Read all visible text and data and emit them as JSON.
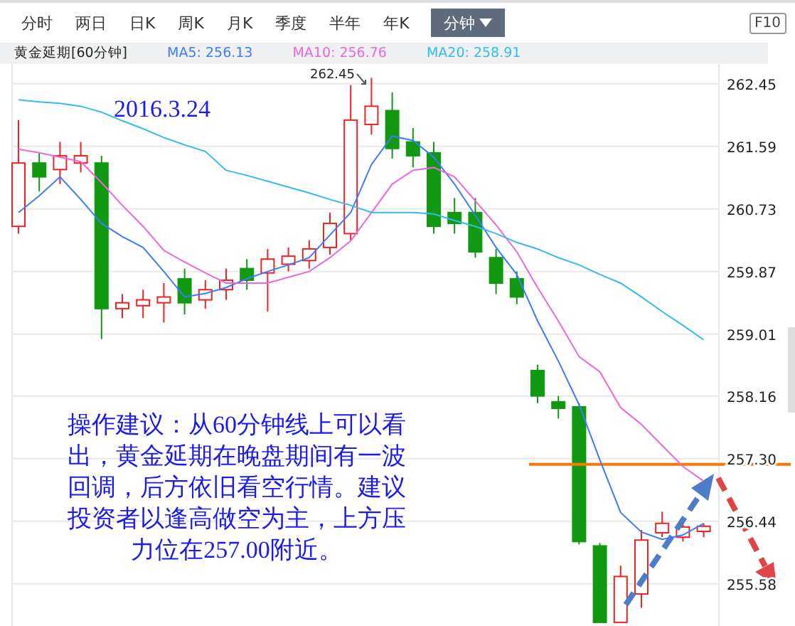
{
  "tabs": [
    {
      "label": "分时",
      "selected": false
    },
    {
      "label": "两日",
      "selected": false
    },
    {
      "label": "日K",
      "selected": false
    },
    {
      "label": "周K",
      "selected": false
    },
    {
      "label": "月K",
      "selected": false
    },
    {
      "label": "季度",
      "selected": false
    },
    {
      "label": "半年",
      "selected": false
    },
    {
      "label": "年K",
      "selected": false
    },
    {
      "label": "分钟",
      "selected": true
    }
  ],
  "f10_button": "F10",
  "info_bar": {
    "title": "黄金延期[60分钟]",
    "averages": [
      {
        "label": "MA5: 256.13",
        "color": "#3a7bff"
      },
      {
        "label": "MA10: 256.76",
        "color": "#ee66dd"
      },
      {
        "label": "MA20: 258.91",
        "color": "#33bbee"
      }
    ]
  },
  "chart": {
    "max_label": "262.45",
    "date_note": "2016.3.24",
    "advice": "操作建议：从60分钟线上可以看出，黄金延期在晚盘期间有一波回调，后方依旧看空行情。建议投资者以逢高做空为主，上方压力位在257.00附近。",
    "chart_data": {
      "type": "candlestick",
      "grid": true,
      "ylim": [
        255.0,
        262.72
      ],
      "yticks": [
        {
          "value": 262.45,
          "label": "262.45"
        },
        {
          "value": 261.59,
          "label": "261.59"
        },
        {
          "value": 260.73,
          "label": "260.73"
        },
        {
          "value": 259.87,
          "label": "259.87"
        },
        {
          "value": 259.01,
          "label": "259.01"
        },
        {
          "value": 258.16,
          "label": "258.16"
        },
        {
          "value": 257.3,
          "label": "257.30"
        },
        {
          "value": 256.44,
          "label": "256.44"
        },
        {
          "value": 255.58,
          "label": "255.58"
        }
      ],
      "ref_lines": [
        {
          "axis": "y",
          "value": 257.22,
          "color": "#ff7700"
        }
      ],
      "ohlc": [
        [
          260.49,
          261.95,
          260.39,
          261.36
        ],
        [
          261.36,
          261.5,
          260.97,
          261.17
        ],
        [
          261.27,
          261.65,
          261.07,
          261.46
        ],
        [
          261.36,
          261.65,
          261.23,
          261.46
        ],
        [
          261.36,
          261.46,
          258.94,
          259.36
        ],
        [
          259.36,
          259.56,
          259.23,
          259.44
        ],
        [
          259.4,
          259.62,
          259.23,
          259.48
        ],
        [
          259.44,
          259.71,
          259.17,
          259.52
        ],
        [
          259.77,
          259.91,
          259.28,
          259.44
        ],
        [
          259.48,
          259.75,
          259.36,
          259.62
        ],
        [
          259.62,
          259.91,
          259.48,
          259.75
        ],
        [
          259.91,
          260.04,
          259.62,
          259.75
        ],
        [
          259.85,
          260.18,
          259.32,
          260.04
        ],
        [
          259.97,
          260.2,
          259.87,
          260.08
        ],
        [
          260.02,
          260.3,
          259.91,
          260.18
        ],
        [
          260.2,
          260.68,
          260.1,
          260.53
        ],
        [
          260.39,
          262.43,
          260.3,
          261.95
        ],
        [
          261.89,
          262.53,
          261.75,
          262.14
        ],
        [
          262.08,
          262.33,
          261.42,
          261.56
        ],
        [
          261.65,
          261.84,
          261.3,
          261.46
        ],
        [
          261.5,
          261.65,
          260.39,
          260.49
        ],
        [
          260.68,
          260.88,
          260.39,
          260.53
        ],
        [
          260.68,
          260.88,
          260.06,
          260.14
        ],
        [
          260.06,
          260.18,
          259.56,
          259.71
        ],
        [
          259.77,
          259.87,
          259.42,
          259.52
        ],
        [
          258.51,
          258.59,
          258.06,
          258.16
        ],
        [
          258.08,
          258.16,
          257.85,
          257.99
        ],
        [
          258.01,
          258.06,
          256.12,
          256.16
        ],
        [
          256.1,
          256.14,
          255.05,
          255.05
        ],
        [
          255.05,
          255.83,
          255.05,
          255.68
        ],
        [
          255.44,
          256.32,
          255.25,
          256.18
        ],
        [
          256.28,
          256.57,
          256.22,
          256.41
        ],
        [
          256.22,
          256.45,
          256.16,
          256.36
        ],
        [
          256.3,
          256.41,
          256.22,
          256.37
        ]
      ]
    }
  },
  "moving_averages": {
    "chart_data": {
      "type": "line",
      "ylim": [
        255.0,
        262.72
      ],
      "series": [
        {
          "color": "#3a7bff",
          "values": [
            260.68,
            260.91,
            261.17,
            260.86,
            260.53,
            260.35,
            260.2,
            259.87,
            259.52,
            259.57,
            259.65,
            259.77,
            259.87,
            259.96,
            260.06,
            260.37,
            260.68,
            261.34,
            261.73,
            261.67,
            261.44,
            261.07,
            260.64,
            260.2,
            259.83,
            259.19,
            258.64,
            258.04,
            257.28,
            256.56,
            256.29,
            256.19,
            256.25,
            256.41
          ]
        },
        {
          "color": "#ee66dd",
          "values": [
            261.55,
            261.5,
            261.44,
            261.38,
            261.09,
            260.78,
            260.49,
            260.16,
            260.0,
            259.85,
            259.71,
            259.71,
            259.71,
            259.79,
            259.87,
            260.06,
            260.29,
            260.68,
            261.07,
            261.26,
            261.3,
            261.17,
            260.84,
            260.51,
            260.14,
            259.65,
            259.19,
            258.7,
            258.49,
            258.0,
            257.77,
            257.48,
            257.19,
            256.99
          ]
        },
        {
          "color": "#33bbee",
          "values": [
            262.23,
            262.2,
            262.18,
            262.14,
            262.06,
            261.94,
            261.83,
            261.71,
            261.61,
            261.52,
            261.26,
            261.19,
            261.11,
            261.03,
            260.95,
            260.86,
            260.78,
            260.68,
            260.68,
            260.68,
            260.66,
            260.57,
            260.49,
            260.39,
            260.27,
            260.18,
            260.06,
            259.96,
            259.83,
            259.71,
            259.52,
            259.32,
            259.13,
            258.93
          ]
        }
      ]
    }
  }
}
